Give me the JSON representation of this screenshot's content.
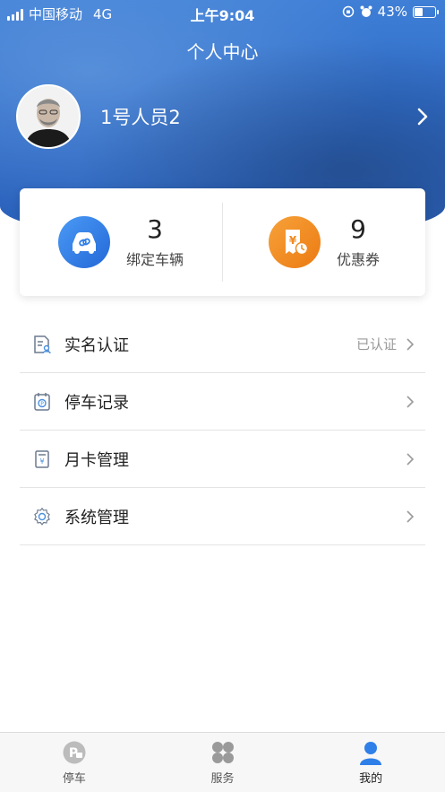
{
  "status_bar": {
    "carrier": "中国移动",
    "network": "4G",
    "time": "上午9:04",
    "battery": "43%",
    "battery_level": 0.43
  },
  "header": {
    "title": "个人中心",
    "username": "1号人员2"
  },
  "stats": [
    {
      "value": "3",
      "label": "绑定车辆",
      "icon": "car-link-icon",
      "color": "#2f7fe8"
    },
    {
      "value": "9",
      "label": "优惠券",
      "icon": "coupon-icon",
      "color": "#f08a1f"
    }
  ],
  "menu": [
    {
      "label": "实名认证",
      "status": "已认证",
      "icon": "id-card-icon"
    },
    {
      "label": "停车记录",
      "status": "",
      "icon": "parking-record-icon"
    },
    {
      "label": "月卡管理",
      "status": "",
      "icon": "monthly-card-icon"
    },
    {
      "label": "系统管理",
      "status": "",
      "icon": "settings-icon"
    }
  ],
  "tabs": [
    {
      "label": "停车",
      "icon": "parking-icon",
      "active": false
    },
    {
      "label": "服务",
      "icon": "services-grid-icon",
      "active": false
    },
    {
      "label": "我的",
      "icon": "user-icon",
      "active": true
    }
  ],
  "colors": {
    "header_blue": "#2f6cc8",
    "accent_blue": "#2f7fe8",
    "accent_orange": "#f08a1f"
  }
}
